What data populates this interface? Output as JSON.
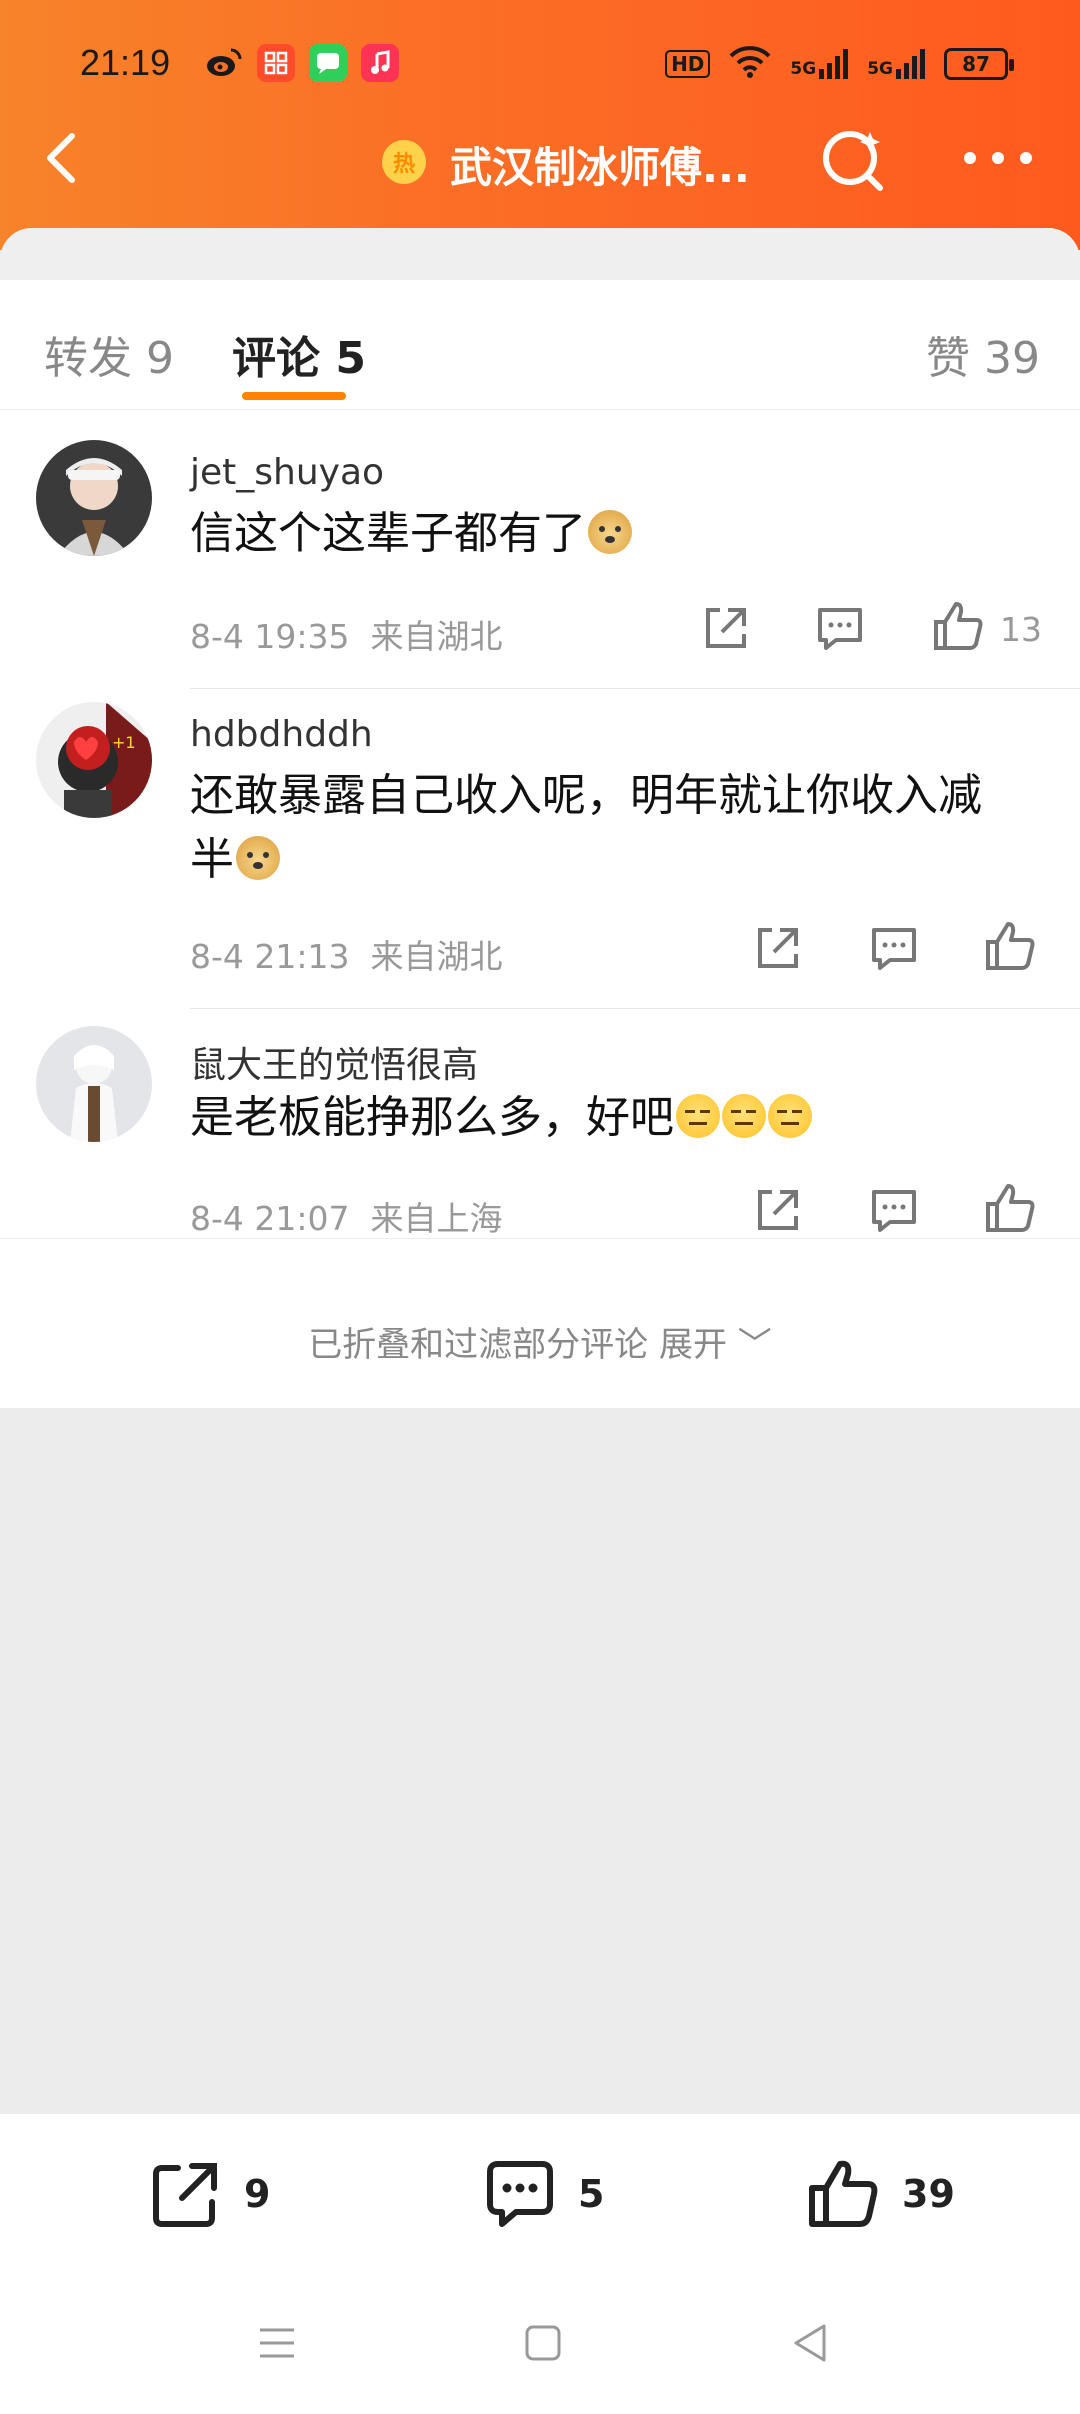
{
  "status_bar": {
    "time": "21:19",
    "battery": "87",
    "hd_label": "HD",
    "net1": "5G",
    "net2": "5G"
  },
  "nav": {
    "topic_badge": "热",
    "title": "武汉制冰师傅..."
  },
  "tabs": {
    "forward": "转发 9",
    "comment": "评论 5",
    "like": "赞 39"
  },
  "comments": [
    {
      "user": "jet_shuyao",
      "text": "信这个这辈子都有了",
      "emoji": "doge",
      "time": "8-4 19:35",
      "location": "来自湖北",
      "likes": "13"
    },
    {
      "user": "hdbdhddh",
      "text_line1": "还敢暴露自己收入呢，明年就让你收入减",
      "text_line2": "半",
      "emoji": "doge",
      "time": "8-4 21:13",
      "location": "来自湖北",
      "likes": ""
    },
    {
      "user": "鼠大王的觉悟很高",
      "text": "是老板能挣那么多，好吧",
      "emoji": "awkward x3",
      "time": "8-4 21:07",
      "location": "来自上海",
      "likes": ""
    }
  ],
  "fold": {
    "text": "已折叠和过滤部分评论 展开 ﹀"
  },
  "bottom_bar": {
    "forward_count": "9",
    "comment_count": "5",
    "like_count": "39"
  },
  "colors": {
    "header_orange": "#fb6f26",
    "accent": "#ff8200"
  }
}
